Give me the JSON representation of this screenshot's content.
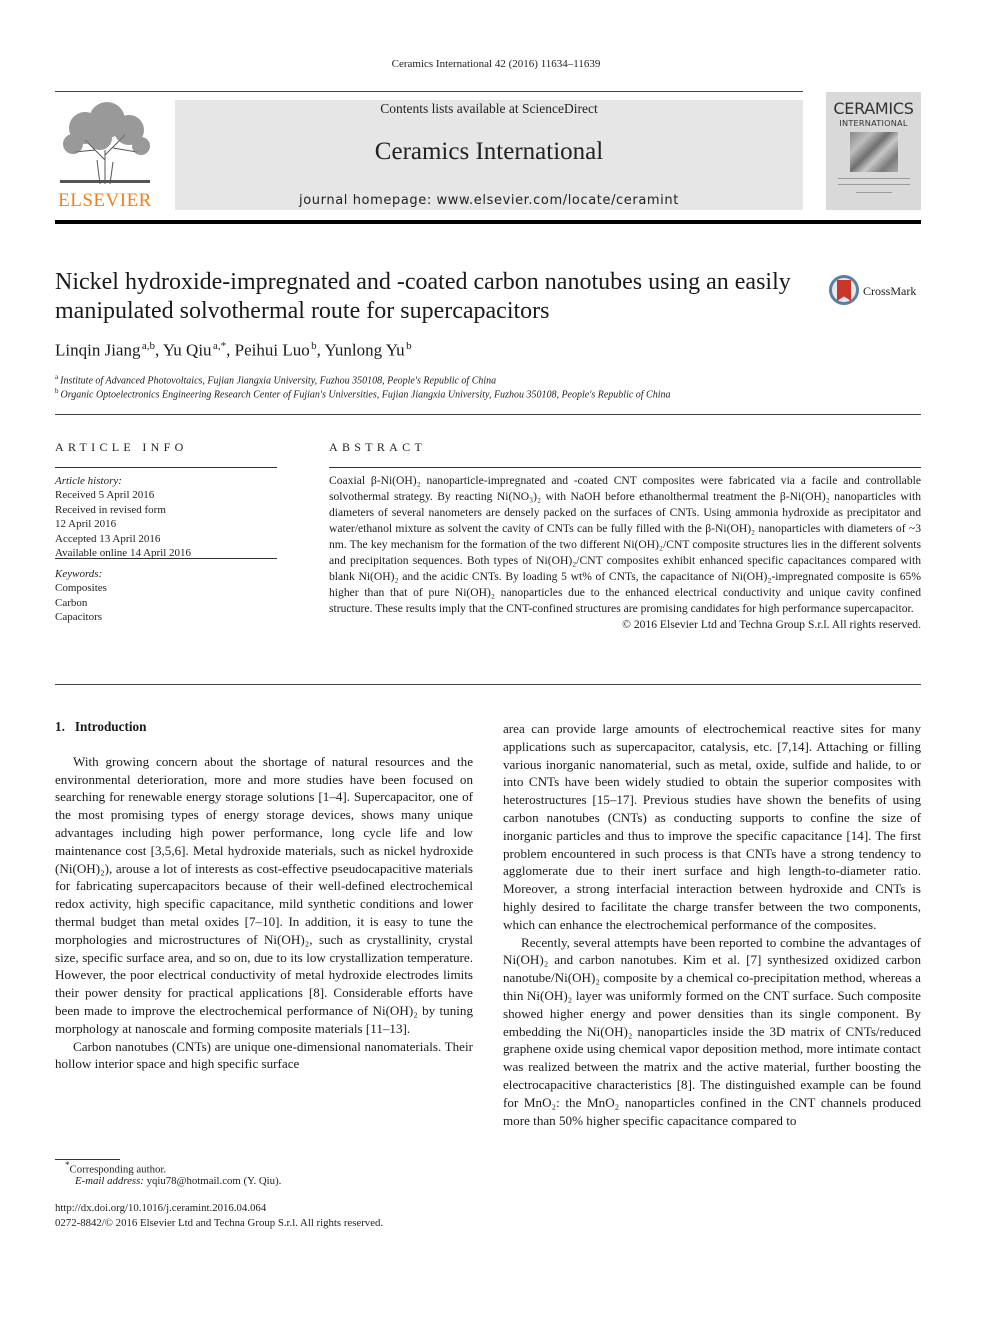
{
  "running_head": "Ceramics International 42 (2016) 11634–11639",
  "masthead": {
    "publisher_logo_text": "ELSEVIER",
    "contents_line": "Contents lists available at ScienceDirect",
    "journal_name": "Ceramics International",
    "homepage_line": "journal homepage: www.elsevier.com/locate/ceramint",
    "cover": {
      "line1": "CERAMICS",
      "line2": "INTERNATIONAL"
    }
  },
  "article": {
    "title": "Nickel hydroxide-impregnated and -coated carbon nanotubes using an easily manipulated solvothermal route for supercapacitors",
    "crossmark_label": "CrossMark",
    "authors": [
      {
        "name": "Linqin Jiang",
        "sup": "a,b",
        "sep": ", "
      },
      {
        "name": "Yu Qiu",
        "sup": "a,*",
        "sep": ", "
      },
      {
        "name": "Peihui Luo",
        "sup": "b",
        "sep": ", "
      },
      {
        "name": "Yunlong Yu",
        "sup": "b",
        "sep": ""
      }
    ],
    "affiliations": [
      {
        "mark": "a",
        "text": "Institute of Advanced Photovoltaics, Fujian Jiangxia University, Fuzhou 350108, People's Republic of China"
      },
      {
        "mark": "b",
        "text": "Organic Optoelectronics Engineering Research Center of Fujian's Universities, Fujian Jiangxia University, Fuzhou 350108, People's Republic of China"
      }
    ]
  },
  "article_info": {
    "heading": "ARTICLE INFO",
    "history_label": "Article history:",
    "history": [
      "Received 5 April 2016",
      "Received in revised form",
      "12 April 2016",
      "Accepted 13 April 2016",
      "Available online 14 April 2016"
    ],
    "keywords_label": "Keywords:",
    "keywords": [
      "Composites",
      "Carbon",
      "Capacitors"
    ]
  },
  "abstract": {
    "heading": "ABSTRACT",
    "text": "Coaxial β-Ni(OH)₂ nanoparticle-impregnated and -coated CNT composites were fabricated via a facile and controllable solvothermal strategy. By reacting Ni(NO₃)₂ with NaOH before ethanolthermal treatment the β-Ni(OH)₂ nanoparticles with diameters of several nanometers are densely packed on the surfaces of CNTs. Using ammonia hydroxide as precipitator and water/ethanol mixture as solvent the cavity of CNTs can be fully filled with the β-Ni(OH)₂ nanoparticles with diameters of ~3 nm. The key mechanism for the formation of the two different Ni(OH)₂/CNT composite structures lies in the different solvents and precipitation sequences. Both types of Ni(OH)₂/CNT composites exhibit enhanced specific capacitances compared with blank Ni(OH)₂ and the acidic CNTs. By loading 5 wt% of CNTs, the capacitance of Ni(OH)₂-impregnated composite is 65% higher than that of pure Ni(OH)₂ nanoparticles due to the enhanced electrical conductivity and unique cavity confined structure. These results imply that the CNT-confined structures are promising candidates for high performance supercapacitor.",
    "copyright": "© 2016 Elsevier Ltd and Techna Group S.r.l. All rights reserved."
  },
  "body": {
    "section_number": "1.",
    "section_title": "Introduction",
    "left_paragraphs": [
      "With growing concern about the shortage of natural resources and the environmental deterioration, more and more studies have been focused on searching for renewable energy storage solutions [1–4]. Supercapacitor, one of the most promising types of energy storage devices, shows many unique advantages including high power performance, long cycle life and low maintenance cost [3,5,6]. Metal hydroxide materials, such as nickel hydroxide (Ni(OH)₂), arouse a lot of interests as cost-effective pseudocapacitive materials for fabricating supercapacitors because of their well-defined electrochemical redox activity, high specific capacitance, mild synthetic conditions and lower thermal budget than metal oxides [7–10]. In addition, it is easy to tune the morphologies and microstructures of Ni(OH)₂, such as crystallinity, crystal size, specific surface area, and so on, due to its low crystallization temperature. However, the poor electrical conductivity of metal hydroxide electrodes limits their power density for practical applications [8]. Considerable efforts have been made to improve the electrochemical performance of Ni(OH)₂ by tuning morphology at nanoscale and forming composite materials [11–13].",
      "Carbon nanotubes (CNTs) are unique one-dimensional nanomaterials. Their hollow interior space and high specific surface"
    ],
    "right_paragraphs": [
      "area can provide large amounts of electrochemical reactive sites for many applications such as supercapacitor, catalysis, etc. [7,14]. Attaching or filling various inorganic nanomaterial, such as metal, oxide, sulfide and halide, to or into CNTs have been widely studied to obtain the superior composites with heterostructures [15–17]. Previous studies have shown the benefits of using carbon nanotubes (CNTs) as conducting supports to confine the size of inorganic particles and thus to improve the specific capacitance [14]. The first problem encountered in such process is that CNTs have a strong tendency to agglomerate due to their inert surface and high length-to-diameter ratio. Moreover, a strong interfacial interaction between hydroxide and CNTs is highly desired to facilitate the charge transfer between the two components, which can enhance the electrochemical performance of the composites.",
      "Recently, several attempts have been reported to combine the advantages of Ni(OH)₂ and carbon nanotubes. Kim et al. [7] synthesized oxidized carbon nanotube/Ni(OH)₂ composite by a chemical co-precipitation method, whereas a thin Ni(OH)₂ layer was uniformly formed on the CNT surface. Such composite showed higher energy and power densities than its single component. By embedding the Ni(OH)₂ nanoparticles inside the 3D matrix of CNTs/reduced graphene oxide using chemical vapor deposition method, more intimate contact was realized between the matrix and the active material, further boosting the electrocapacitive characteristics [8]. The distinguished example can be found for MnO₂: the MnO₂ nanoparticles confined in the CNT channels produced more than 50% higher specific capacitance compared to"
    ]
  },
  "footer": {
    "corresponding_mark": "*",
    "corresponding_text": "Corresponding author.",
    "email_label": "E-mail address:",
    "email_value": "yqiu78@hotmail.com (Y. Qiu).",
    "doi": "http://dx.doi.org/10.1016/j.ceramint.2016.04.064",
    "issn_line": "0272-8842/© 2016 Elsevier Ltd and Techna Group S.r.l. All rights reserved."
  }
}
